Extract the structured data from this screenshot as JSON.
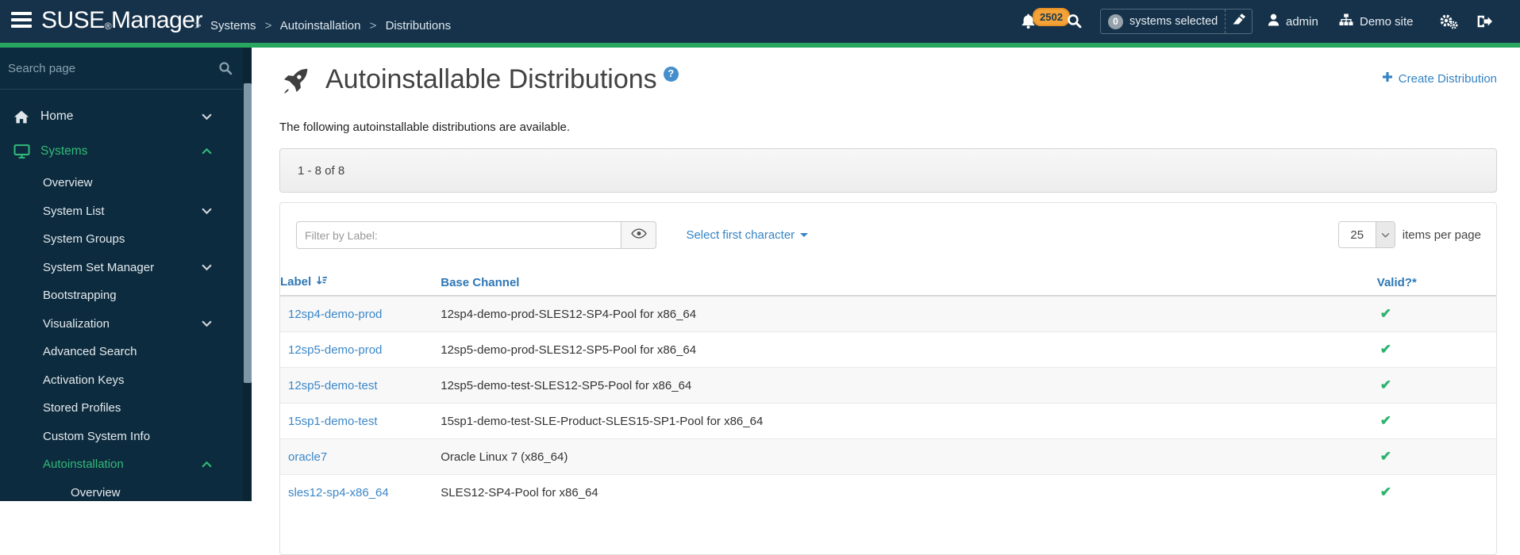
{
  "header": {
    "brand_suse": "SUSE",
    "brand_reg": "®",
    "brand_manager": "Manager",
    "breadcrumb_separator": ">",
    "breadcrumb": [
      "Systems",
      "Autoinstallation",
      "Distributions"
    ],
    "notifications_count": "2502",
    "systems_selected": {
      "count": "0",
      "label": "systems selected"
    },
    "user": "admin",
    "org": "Demo site"
  },
  "sidebar": {
    "search_placeholder": "Search page",
    "items": [
      {
        "label": "Home",
        "icon": "home",
        "level": 0,
        "chevron": "down",
        "active": false
      },
      {
        "label": "Systems",
        "icon": "desktop",
        "level": 0,
        "chevron": "up",
        "active": true
      },
      {
        "label": "Overview",
        "level": 1
      },
      {
        "label": "System List",
        "level": 1,
        "chevron": "down"
      },
      {
        "label": "System Groups",
        "level": 1
      },
      {
        "label": "System Set Manager",
        "level": 1,
        "chevron": "down"
      },
      {
        "label": "Bootstrapping",
        "level": 1
      },
      {
        "label": "Visualization",
        "level": 1,
        "chevron": "down"
      },
      {
        "label": "Advanced Search",
        "level": 1
      },
      {
        "label": "Activation Keys",
        "level": 1
      },
      {
        "label": "Stored Profiles",
        "level": 1
      },
      {
        "label": "Custom System Info",
        "level": 1
      },
      {
        "label": "Autoinstallation",
        "level": 1,
        "chevron": "up",
        "active": true
      },
      {
        "label": "Overview",
        "level": 2
      }
    ]
  },
  "page": {
    "title": "Autoinstallable Distributions",
    "help_glyph": "?",
    "create_label": "Create Distribution",
    "description": "The following autoinstallable distributions are available.",
    "pagination_summary": "1 - 8 of 8",
    "filter_placeholder": "Filter by Label:",
    "select_first_character": "Select first character",
    "items_per_page_value": "25",
    "items_per_page_label": "items per page"
  },
  "table": {
    "columns": [
      "Label",
      "Base Channel",
      "Valid?*"
    ],
    "valid_glyph": "✔",
    "rows": [
      {
        "label": "12sp4-demo-prod",
        "base_channel": "12sp4-demo-prod-SLES12-SP4-Pool for x86_64",
        "valid": true
      },
      {
        "label": "12sp5-demo-prod",
        "base_channel": "12sp5-demo-prod-SLES12-SP5-Pool for x86_64",
        "valid": true
      },
      {
        "label": "12sp5-demo-test",
        "base_channel": "12sp5-demo-test-SLES12-SP5-Pool for x86_64",
        "valid": true
      },
      {
        "label": "15sp1-demo-test",
        "base_channel": "15sp1-demo-test-SLE-Product-SLES15-SP1-Pool for x86_64",
        "valid": true
      },
      {
        "label": "oracle7",
        "base_channel": "Oracle Linux 7 (x86_64)",
        "valid": true
      },
      {
        "label": "sles12-sp4-x86_64",
        "base_channel": "SLES12-SP4-Pool for x86_64",
        "valid": true
      }
    ]
  },
  "colors": {
    "accent_green": "#28a55f",
    "sidebar_active_green": "#30ba78",
    "link_blue": "#3584c4",
    "table_header_blue": "#2e77b5",
    "badge_orange": "#f2a236",
    "valid_check_green": "#2cb36d"
  }
}
